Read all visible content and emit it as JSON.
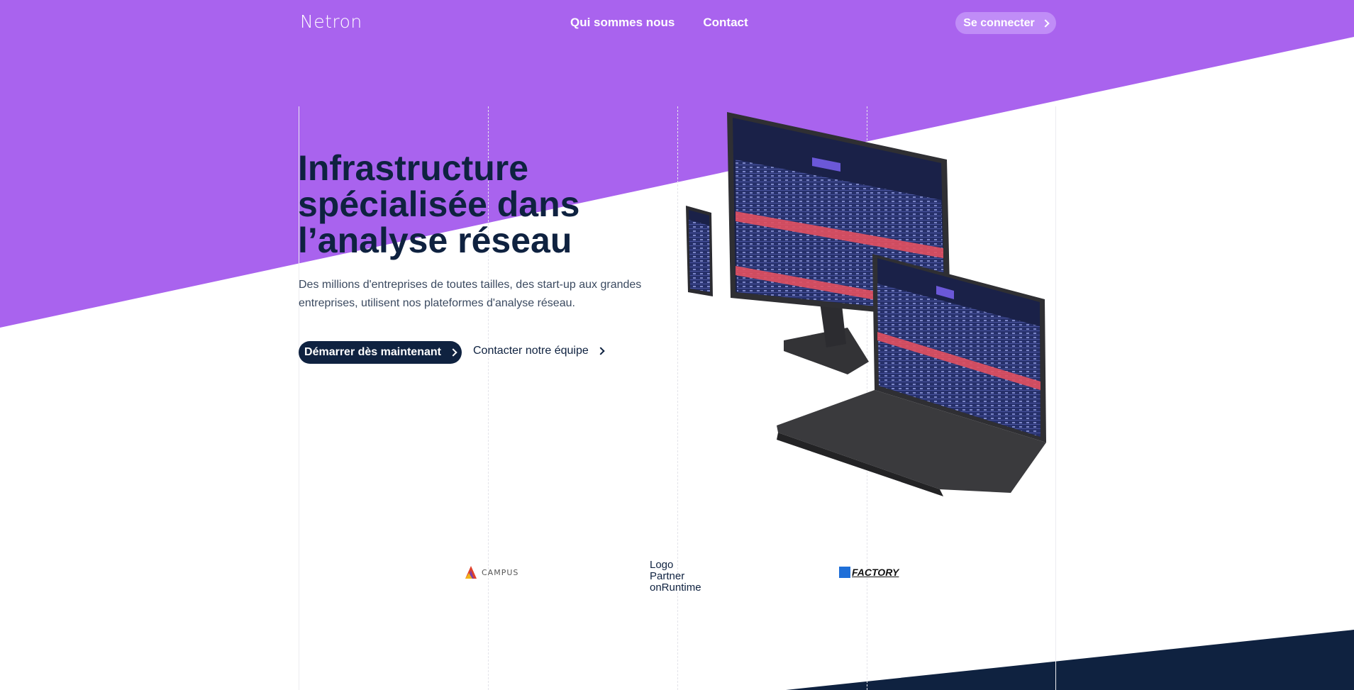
{
  "colors": {
    "purple": "#a963ee",
    "navy": "#0f2240",
    "login_bg": "#c08df7"
  },
  "header": {
    "logo": "Netron",
    "nav": [
      "Qui sommes nous",
      "Contact"
    ],
    "login_label": "Se connecter"
  },
  "hero": {
    "title_lines": [
      "Infrastructure",
      "spécialisée dans",
      "l’analyse réseau"
    ],
    "description_lines": [
      "Des millions d'entreprises de toutes tailles, des start-up aux grandes",
      "entreprises, utilisent nos plateformes d'analyse réseau."
    ],
    "cta_primary": "Démarrer dès maintenant",
    "cta_secondary": "Contacter notre équipe"
  },
  "partners": {
    "campus": "CAMPUS",
    "runtime_alt_lines": [
      "Logo",
      "Partner",
      "onRuntime"
    ],
    "factory": "FACTORY"
  },
  "icons": {
    "chevron": "chevron-right-icon"
  }
}
